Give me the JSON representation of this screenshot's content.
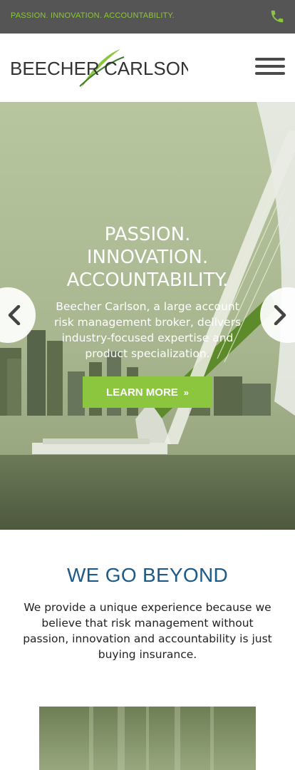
{
  "topbar": {
    "tagline": "PASSION. INNOVATION. ACCOUNTABILITY.",
    "phone_icon": "phone-icon"
  },
  "header": {
    "logo_left": "BEECHER",
    "logo_right": "CARLSON",
    "menu_icon": "hamburger-icon"
  },
  "hero": {
    "title_lines": [
      "PASSION.",
      "INNOVATION.",
      "ACCOUNTABILITY."
    ],
    "description": "Beecher Carlson, a large account risk management broker, delivers industry-focused expertise and product specialization.",
    "cta_label": "LEARN MORE",
    "cta_icon": "double-chevron-right-icon",
    "prev_icon": "chevron-left-icon",
    "next_icon": "chevron-right-icon"
  },
  "section": {
    "heading": "WE GO BEYOND",
    "body": "We provide a unique experience because we believe that risk management without passion, innovation and accountability is just buying insurance."
  },
  "colors": {
    "accent_green": "#8cc63f",
    "topbar_gray": "#555555",
    "heading_blue": "#1c5a8a"
  }
}
